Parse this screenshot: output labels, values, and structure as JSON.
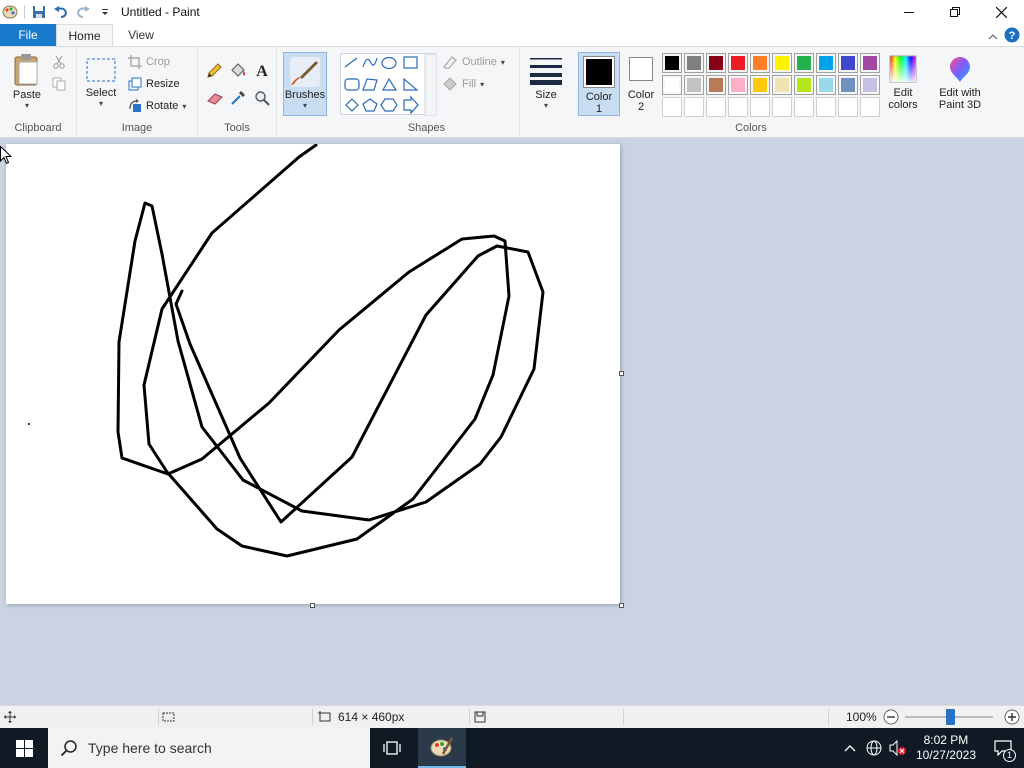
{
  "window": {
    "title": "Untitled - Paint"
  },
  "tabs": {
    "file": "File",
    "home": "Home",
    "view": "View"
  },
  "ribbon": {
    "clipboard": {
      "label": "Clipboard",
      "paste": "Paste"
    },
    "image": {
      "label": "Image",
      "select": "Select",
      "crop": "Crop",
      "resize": "Resize",
      "rotate": "Rotate"
    },
    "tools": {
      "label": "Tools"
    },
    "brushes": {
      "label": "Brushes"
    },
    "shapes": {
      "label": "Shapes",
      "outline": "Outline",
      "fill": "Fill"
    },
    "size": {
      "label": "Size"
    },
    "colors": {
      "label": "Colors",
      "color1": "Color",
      "color1_num": "1",
      "color2": "Color",
      "color2_num": "2",
      "edit_colors_line1": "Edit",
      "edit_colors_line2": "colors",
      "paint3d_line1": "Edit with",
      "paint3d_line2": "Paint 3D",
      "color1_value": "#000000",
      "color2_value": "#ffffff",
      "palette_row1": [
        "#000000",
        "#7f7f7f",
        "#880015",
        "#ed1c24",
        "#ff7f27",
        "#fff200",
        "#22b14c",
        "#00a2e8",
        "#3f48cc",
        "#a349a4"
      ],
      "palette_row2": [
        "#ffffff",
        "#c3c3c3",
        "#b97a57",
        "#ffaec9",
        "#ffc90e",
        "#efe4b0",
        "#b5e61d",
        "#99d9ea",
        "#7092be",
        "#c8bfe7"
      ]
    }
  },
  "status": {
    "canvas_size": "614 × 460px",
    "zoom": "100%"
  },
  "taskbar": {
    "search_placeholder": "Type here to search",
    "time": "8:02 PM",
    "date": "10/27/2023",
    "notification_count": "1"
  }
}
